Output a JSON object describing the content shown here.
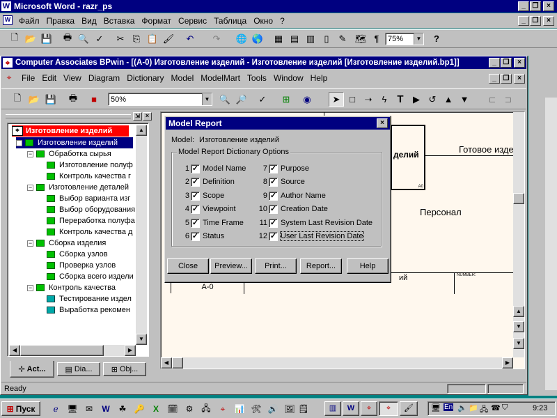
{
  "word": {
    "title": "Microsoft Word - razr_ps",
    "menu": [
      "Файл",
      "Правка",
      "Вид",
      "Вставка",
      "Формат",
      "Сервис",
      "Таблица",
      "Окно",
      "?"
    ],
    "zoom": "75%"
  },
  "bpwin": {
    "title": "Computer Associates BPwin - [(A-0) Изготовление изделий - Изготовление изделий  [Изготовление изделий.bp1]]",
    "menu": [
      "File",
      "Edit",
      "View",
      "Diagram",
      "Dictionary",
      "Model",
      "ModelMart",
      "Tools",
      "Window",
      "Help"
    ],
    "zoom": "50%",
    "status": "Ready"
  },
  "tree": {
    "root": "Изготовление изделий",
    "items": [
      "Изготовление изделий",
      "Обработка  сырья",
      "Изготовление полуф",
      "Контроль качества г",
      "Изготовление  деталей",
      "Выбор  варианта изг",
      "Выбор оборудования",
      "Переработка полуфа",
      "Контроль качества д",
      "Сборка изделия",
      "Сборка узлов",
      "Проверка узлов",
      "Сборка всего издели",
      "Контроль качества",
      "Тестирование издел",
      "Выработка рекомен"
    ],
    "tabs": [
      "Act...",
      "Dia...",
      "Obj..."
    ]
  },
  "diagram": {
    "box_title": "делий",
    "output_label": "Готовое изде",
    "mechanism_label": "Персонал",
    "footer_node": "A-0",
    "footer_title": "ий",
    "footer_number": "NUMBER:"
  },
  "dialog": {
    "title": "Model Report",
    "model_label": "Model:",
    "model_value": "Изготовление изделий",
    "group_label": "Model Report Dictionary Options",
    "options_left": [
      {
        "num": "1",
        "label": "Model Name",
        "checked": true
      },
      {
        "num": "2",
        "label": "Definition",
        "checked": true
      },
      {
        "num": "3",
        "label": "Scope",
        "checked": true
      },
      {
        "num": "4",
        "label": "Viewpoint",
        "checked": true
      },
      {
        "num": "5",
        "label": "Time Frame",
        "checked": true
      },
      {
        "num": "6",
        "label": "Status",
        "checked": true
      }
    ],
    "options_right": [
      {
        "num": "7",
        "label": "Purpose",
        "checked": true
      },
      {
        "num": "8",
        "label": "Source",
        "checked": true
      },
      {
        "num": "9",
        "label": "Author Name",
        "checked": true
      },
      {
        "num": "10",
        "label": "Creation Date",
        "checked": true
      },
      {
        "num": "11",
        "label": "System Last Revision Date",
        "checked": true
      },
      {
        "num": "12",
        "label": "User Last Revision Date",
        "checked": true
      }
    ],
    "buttons": {
      "close": "Close",
      "preview": "Preview...",
      "print": "Print...",
      "report": "Report...",
      "help": "Help"
    }
  },
  "taskbar": {
    "start": "Пуск",
    "lang": "En",
    "clock": "9:23"
  }
}
